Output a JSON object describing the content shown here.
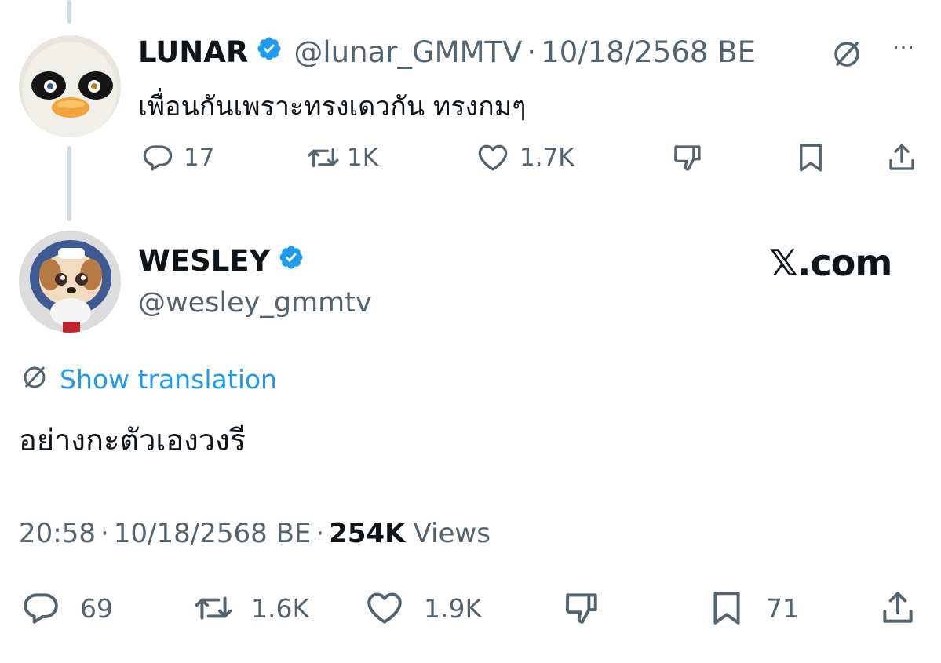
{
  "colors": {
    "accent": "#1d9bf0",
    "text": "#0f1419",
    "muted": "#536471",
    "verified": "#1d9bf0"
  },
  "parent_tweet": {
    "display_name": "LUNAR",
    "handle": "@lunar_GMMTV",
    "separator": "·",
    "date": "10/18/2568 BE",
    "text": "เพื่อนกันเพราะทรงเดวกัน ทรงกมๆ",
    "more_icon": "···",
    "counts": {
      "replies": "17",
      "reposts": "1K",
      "likes": "1.7K"
    }
  },
  "main_tweet": {
    "display_name": "WESLEY",
    "handle": "@wesley_gmmtv",
    "brand": "𝕏.com",
    "show_translation": "Show translation",
    "text": "อย่างกะตัวเองวงรี",
    "time": "20:58",
    "sep1": "·",
    "date": "10/18/2568 BE",
    "sep2": "·",
    "views_count": "254K",
    "views_label": "Views",
    "counts": {
      "replies": "69",
      "reposts": "1.6K",
      "likes": "1.9K",
      "bookmarks": "71"
    }
  },
  "icons": [
    "verified-icon",
    "translate-icon",
    "more-icon",
    "reply-icon",
    "repost-icon",
    "like-icon",
    "dislike-icon",
    "bookmark-icon",
    "share-icon"
  ]
}
